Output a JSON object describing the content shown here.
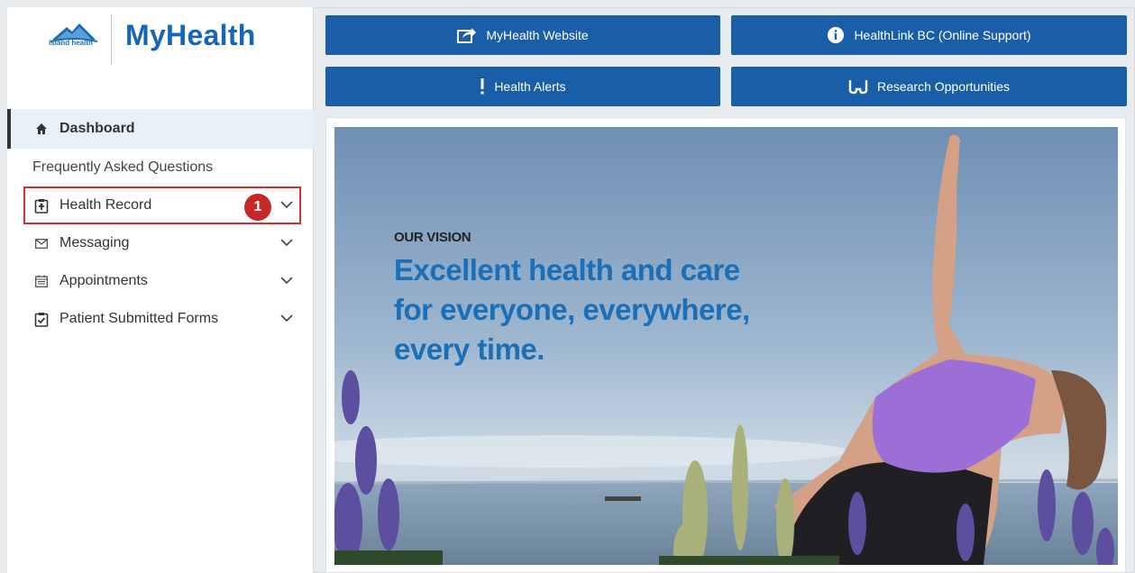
{
  "brand": {
    "org_text": "island health",
    "app_name": "MyHealth"
  },
  "top_buttons": [
    {
      "label": "MyHealth Website",
      "icon": "external-link-icon"
    },
    {
      "label": "HealthLink BC (Online Support)",
      "icon": "info-icon"
    },
    {
      "label": "Health Alerts",
      "icon": "exclamation-icon"
    },
    {
      "label": "Research Opportunities",
      "icon": "glasses-icon"
    }
  ],
  "sidebar": {
    "items": [
      {
        "label": "Dashboard",
        "icon": "home-icon",
        "active": true
      },
      {
        "label": "Frequently Asked Questions"
      },
      {
        "label": "Health Record",
        "icon": "medical-clipboard-icon",
        "expandable": true,
        "highlighted": true,
        "step": "1"
      },
      {
        "label": "Messaging",
        "icon": "envelope-icon",
        "expandable": true
      },
      {
        "label": "Appointments",
        "icon": "calendar-icon",
        "expandable": true
      },
      {
        "label": "Patient Submitted Forms",
        "icon": "clipboard-check-icon",
        "expandable": true
      }
    ]
  },
  "hero": {
    "eyebrow": "OUR VISION",
    "lines": [
      "Excellent health and care",
      "for everyone, everywhere,",
      "every time."
    ]
  },
  "colors": {
    "button_blue": "#1a5ea8",
    "brand_blue": "#1565b8",
    "highlight_red": "#d32f2f"
  }
}
